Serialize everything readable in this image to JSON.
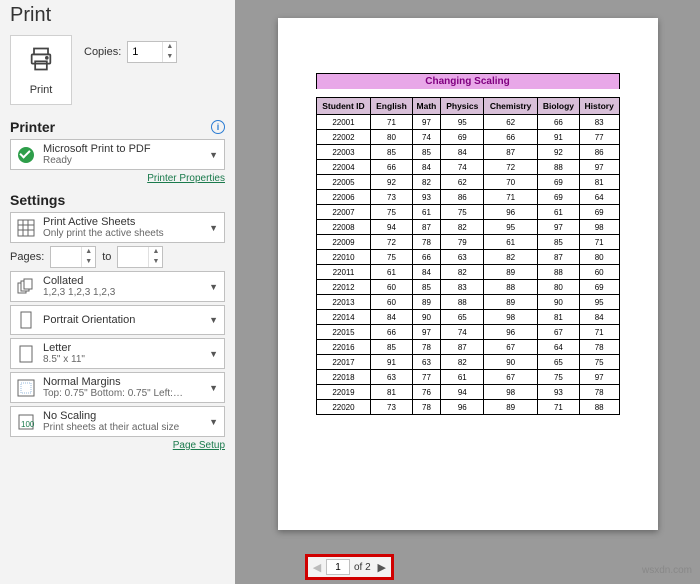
{
  "title": "Print",
  "print_button": "Print",
  "copies": {
    "label": "Copies:",
    "value": "1"
  },
  "printer": {
    "header": "Printer",
    "name": "Microsoft Print to PDF",
    "status": "Ready",
    "properties_link": "Printer Properties"
  },
  "settings": {
    "header": "Settings",
    "print_area": {
      "line1": "Print Active Sheets",
      "line2": "Only print the active sheets"
    },
    "pages": {
      "label": "Pages:",
      "from": "",
      "to_label": "to",
      "to": ""
    },
    "collate": {
      "line1": "Collated",
      "line2": "1,2,3    1,2,3    1,2,3"
    },
    "orientation": {
      "line1": "Portrait Orientation",
      "line2": ""
    },
    "paper": {
      "line1": "Letter",
      "line2": "8.5\" x 11\""
    },
    "margins": {
      "line1": "Normal Margins",
      "line2": "Top: 0.75\" Bottom: 0.75\" Left:…"
    },
    "scaling": {
      "line1": "No Scaling",
      "line2": "Print sheets at their actual size"
    },
    "page_setup_link": "Page Setup"
  },
  "preview": {
    "sheet_title": "Changing Scaling",
    "headers": [
      "Student ID",
      "English",
      "Math",
      "Physics",
      "Chemistry",
      "Biology",
      "History"
    ],
    "rows": [
      [
        "22001",
        "71",
        "97",
        "95",
        "62",
        "66",
        "83"
      ],
      [
        "22002",
        "80",
        "74",
        "69",
        "66",
        "91",
        "77"
      ],
      [
        "22003",
        "85",
        "85",
        "84",
        "87",
        "92",
        "86"
      ],
      [
        "22004",
        "66",
        "84",
        "74",
        "72",
        "88",
        "97"
      ],
      [
        "22005",
        "92",
        "82",
        "62",
        "70",
        "69",
        "81"
      ],
      [
        "22006",
        "73",
        "93",
        "86",
        "71",
        "69",
        "64"
      ],
      [
        "22007",
        "75",
        "61",
        "75",
        "96",
        "61",
        "69"
      ],
      [
        "22008",
        "94",
        "87",
        "82",
        "95",
        "97",
        "98"
      ],
      [
        "22009",
        "72",
        "78",
        "79",
        "61",
        "85",
        "71"
      ],
      [
        "22010",
        "75",
        "66",
        "63",
        "82",
        "87",
        "80"
      ],
      [
        "22011",
        "61",
        "84",
        "82",
        "89",
        "88",
        "60"
      ],
      [
        "22012",
        "60",
        "85",
        "83",
        "88",
        "80",
        "69"
      ],
      [
        "22013",
        "60",
        "89",
        "88",
        "89",
        "90",
        "95"
      ],
      [
        "22014",
        "84",
        "90",
        "65",
        "98",
        "81",
        "84"
      ],
      [
        "22015",
        "66",
        "97",
        "74",
        "96",
        "67",
        "71"
      ],
      [
        "22016",
        "85",
        "78",
        "87",
        "67",
        "64",
        "78"
      ],
      [
        "22017",
        "91",
        "63",
        "82",
        "90",
        "65",
        "75"
      ],
      [
        "22018",
        "63",
        "77",
        "61",
        "67",
        "75",
        "97"
      ],
      [
        "22019",
        "81",
        "76",
        "94",
        "98",
        "93",
        "78"
      ],
      [
        "22020",
        "73",
        "78",
        "96",
        "89",
        "71",
        "88"
      ]
    ]
  },
  "pager": {
    "current": "1",
    "total_label": "of 2"
  },
  "watermark": "wsxdn.com"
}
